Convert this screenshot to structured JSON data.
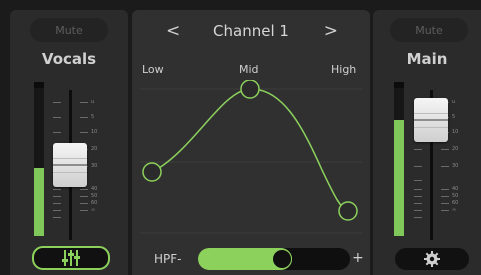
{
  "left_strip": {
    "mute_label": "Mute",
    "name": "Vocals",
    "meter_level": 0.5,
    "fader_scale": [
      "u",
      "5",
      "10",
      "20",
      "30",
      "40",
      "50",
      "60",
      "∞"
    ],
    "eq_button_icon": "eq-sliders-icon"
  },
  "center": {
    "prev_label": "<",
    "next_label": ">",
    "channel_title": "Channel 1",
    "band_labels": {
      "low": "Low",
      "mid": "Mid",
      "high": "High"
    },
    "hpf_label": "HPF-",
    "hpf_plus": "+",
    "hpf_level": 0.55
  },
  "right_strip": {
    "mute_label": "Mute",
    "name": "Main",
    "meter_level": 0.8,
    "fader_scale": [
      "u",
      "5",
      "10",
      "20",
      "30",
      "40",
      "50",
      "60",
      "∞"
    ],
    "settings_icon": "gear-icon"
  },
  "colors": {
    "accent": "#8dd15d",
    "meter": "#80c85a",
    "panel": "#2b2b2b",
    "background": "#1b1b1b"
  }
}
